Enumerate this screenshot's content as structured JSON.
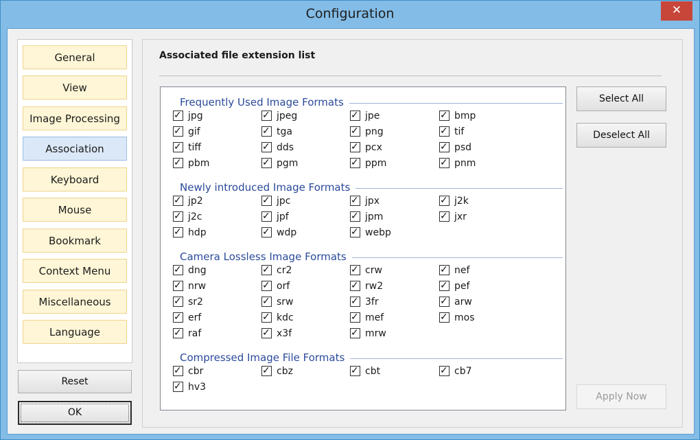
{
  "window": {
    "title": "Configuration",
    "close_symbol": "✕"
  },
  "sidebar": {
    "items": [
      {
        "label": "General"
      },
      {
        "label": "View"
      },
      {
        "label": "Image Processing"
      },
      {
        "label": "Association",
        "active": true
      },
      {
        "label": "Keyboard"
      },
      {
        "label": "Mouse"
      },
      {
        "label": "Bookmark"
      },
      {
        "label": "Context Menu"
      },
      {
        "label": "Miscellaneous"
      },
      {
        "label": "Language"
      }
    ],
    "reset_label": "Reset",
    "ok_label": "OK"
  },
  "main": {
    "section_title": "Associated file extension list",
    "groups": [
      {
        "title": "Frequently Used Image Formats",
        "items": [
          "jpg",
          "jpeg",
          "jpe",
          "bmp",
          "gif",
          "tga",
          "png",
          "tif",
          "tiff",
          "dds",
          "pcx",
          "psd",
          "pbm",
          "pgm",
          "ppm",
          "pnm"
        ]
      },
      {
        "title": "Newly introduced Image Formats",
        "items": [
          "jp2",
          "jpc",
          "jpx",
          "j2k",
          "j2c",
          "jpf",
          "jpm",
          "jxr",
          "hdp",
          "wdp",
          "webp"
        ]
      },
      {
        "title": "Camera Lossless Image Formats",
        "items": [
          "dng",
          "cr2",
          "crw",
          "nef",
          "nrw",
          "orf",
          "rw2",
          "pef",
          "sr2",
          "srw",
          "3fr",
          "arw",
          "erf",
          "kdc",
          "mef",
          "mos",
          "raf",
          "x3f",
          "mrw"
        ]
      },
      {
        "title": "Compressed Image File Formats",
        "items": [
          "cbr",
          "cbz",
          "cbt",
          "cb7",
          "hv3"
        ]
      }
    ],
    "select_all_label": "Select All",
    "deselect_all_label": "Deselect All",
    "apply_now_label": "Apply Now"
  },
  "colors": {
    "accent": "#3f8fc9",
    "nav_item": "#fef6d6",
    "nav_active": "#dbe8f7",
    "group_header": "#2a4a9a"
  }
}
